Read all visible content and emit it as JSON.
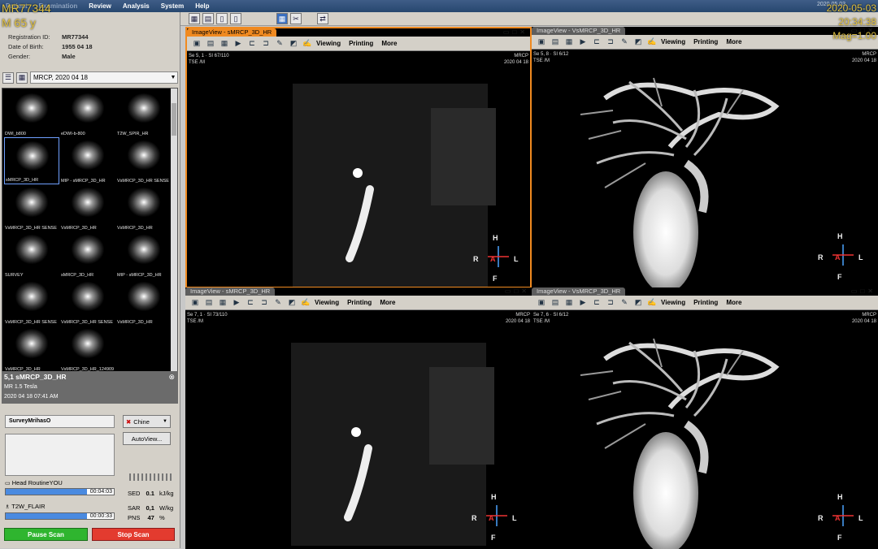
{
  "app": {
    "menu": [
      "Patient",
      "Examination",
      "Review",
      "Analysis",
      "System",
      "Help"
    ],
    "datetime": "2020.05.03"
  },
  "overlay": {
    "tl_line1": "MR77344",
    "tl_line2": "M 65 y",
    "tr_line1": "2020-05-03",
    "tr_line2": "20:34:38",
    "tr_line3": "Mag=1.00"
  },
  "patient": {
    "id_label": "Registration ID:",
    "id": "MR77344",
    "dob_label": "Date of Birth:",
    "dob": "1955 04 18",
    "gender_label": "Gender:",
    "gender": "Male"
  },
  "exam": {
    "selected": "MRCP, 2020 04 18"
  },
  "thumbnails": [
    "DWI_b800",
    "eDWI-b-800",
    "T2W_SPIR_HR",
    "sMRCP_3D_HR",
    "MIP - sMRCP_3D_HR",
    "VsMRCP_3D_HR SENSE",
    "VsMRCP_3D_HR SENSE",
    "VsMRCP_3D_HR",
    "VsMRCP_3D_HR",
    "SURVEY",
    "sMRCP_3D_HR",
    "MIP - sMRCP_3D_HR",
    "VsMRCP_3D_HR SENSE",
    "VsMRCP_3D_HR SENSE",
    "VsMRCP_3D_HR",
    "VsMRCP_3D_HR",
    "VsMRCP_3D_HR_124909"
  ],
  "series": {
    "title": "5,1 sMRCP_3D_HR",
    "line2": "MR   1.5 Tesla",
    "line3": "2020 04 18   07:41 AM"
  },
  "scan": {
    "protocol": "SurveyMrihasO",
    "language": "Chine",
    "autoview": "AutoView...",
    "q1_name": "Head RoutineYOU",
    "q1_time": "00:04:03",
    "q1_progress": 0.75,
    "q2_name": "T2W_FLAIR",
    "q2_time": "00:00:33",
    "q2_progress": 0.75,
    "sed_label": "SED",
    "sed_val": "0.1",
    "sed_unit": "kJ/kg",
    "sar_label": "SAR",
    "sar_val": "0,1",
    "sar_unit": "W/kg",
    "pns_label": "PNS",
    "pns_val": "47",
    "pns_unit": "%",
    "pause": "Pause Scan",
    "stop": "Stop Scan"
  },
  "viewer_menu": {
    "viewing": "Viewing",
    "printing": "Printing",
    "more": "More"
  },
  "viewports": [
    {
      "tab": "ImageView - sMRCP_3D_HR",
      "se": "Se 5, 1 · SI 67/110",
      "seq": "TSE  /M",
      "mod": "MRCP",
      "date": "2020 04 18"
    },
    {
      "tab": "ImageView - VsMRCP_3D_HR",
      "se": "Se 5, 8 · SI 6/12",
      "seq": "TSE  /M",
      "mod": "MRCP",
      "date": "2020 04 18"
    },
    {
      "tab": "ImageView - sMRCP_3D_HR",
      "se": "Se 7, 1 · SI 73/110",
      "seq": "TSE  /M",
      "mod": "MRCP",
      "date": "2020 04 18"
    },
    {
      "tab": "ImageView - VsMRCP_3D_HR",
      "se": "Se 7, 6 · SI 6/12",
      "seq": "TSE  /M",
      "mod": "MRCP",
      "date": "2020 04 18"
    }
  ],
  "orient": {
    "h": "H",
    "r": "R",
    "a": "A",
    "l": "L",
    "f": "F"
  }
}
